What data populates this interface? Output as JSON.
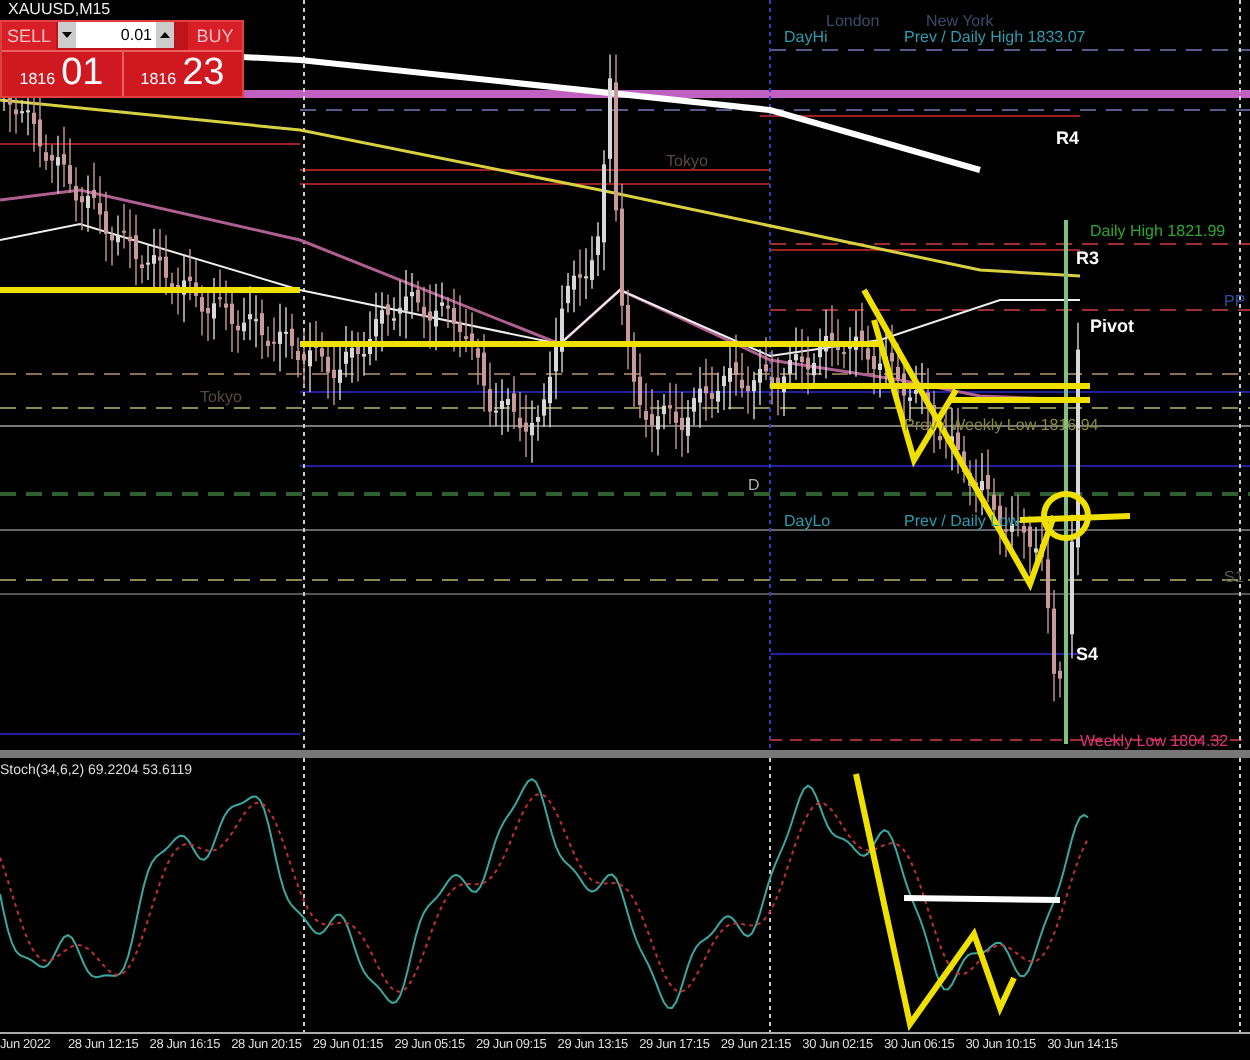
{
  "window": {
    "title": "XAUUSD,M15"
  },
  "trade_panel": {
    "sell": {
      "label": "SELL",
      "price_small": "1816",
      "price_big": "01"
    },
    "lot": {
      "value": "0.01"
    },
    "buy": {
      "label": "BUY",
      "price_small": "1816",
      "price_big": "23"
    }
  },
  "chart_labels": [
    {
      "text": "London",
      "color": "#3c4a6a"
    },
    {
      "text": "New York",
      "color": "#3c4a6a"
    },
    {
      "text": "DayHi",
      "color": "#2a9db0"
    },
    {
      "text": "Prev / Daily High 1833.07",
      "color": "#2a9db0"
    },
    {
      "text": "Tokyo",
      "color": "#5a4848"
    },
    {
      "text": "R4",
      "color": "#ffffff"
    },
    {
      "text": "Daily High 1821.99",
      "color": "#2ea82e"
    },
    {
      "text": "R3",
      "color": "#ffffff"
    },
    {
      "text": "PP",
      "color": "#3050a0"
    },
    {
      "text": "Pivot",
      "color": "#ffffff"
    },
    {
      "text": "Tokyo",
      "color": "#5a4848"
    },
    {
      "text": "Prev / Weekly Low 1816.94",
      "color": "#8a8a3a"
    },
    {
      "text": "D",
      "color": "#b0b0b0"
    },
    {
      "text": "DayLo",
      "color": "#2a9db0"
    },
    {
      "text": "Prev / Daily Low",
      "color": "#2a9db0"
    },
    {
      "text": "S1",
      "color": "#555555"
    },
    {
      "text": "S4",
      "color": "#ffffff"
    },
    {
      "text": "Weekly Low 1804.32",
      "color": "#e0307a"
    }
  ],
  "indicator": {
    "label": "Stoch(34,6,2) 69.2204 53.6119"
  },
  "time_axis": {
    "labels": [
      "Jun 2022",
      "28 Jun 12:15",
      "28 Jun 16:15",
      "28 Jun 20:15",
      "29 Jun 01:15",
      "29 Jun 05:15",
      "29 Jun 09:15",
      "29 Jun 13:15",
      "29 Jun 17:15",
      "29 Jun 21:15",
      "30 Jun 02:15",
      "30 Jun 06:15",
      "30 Jun 10:15",
      "30 Jun 14:15"
    ]
  }
}
